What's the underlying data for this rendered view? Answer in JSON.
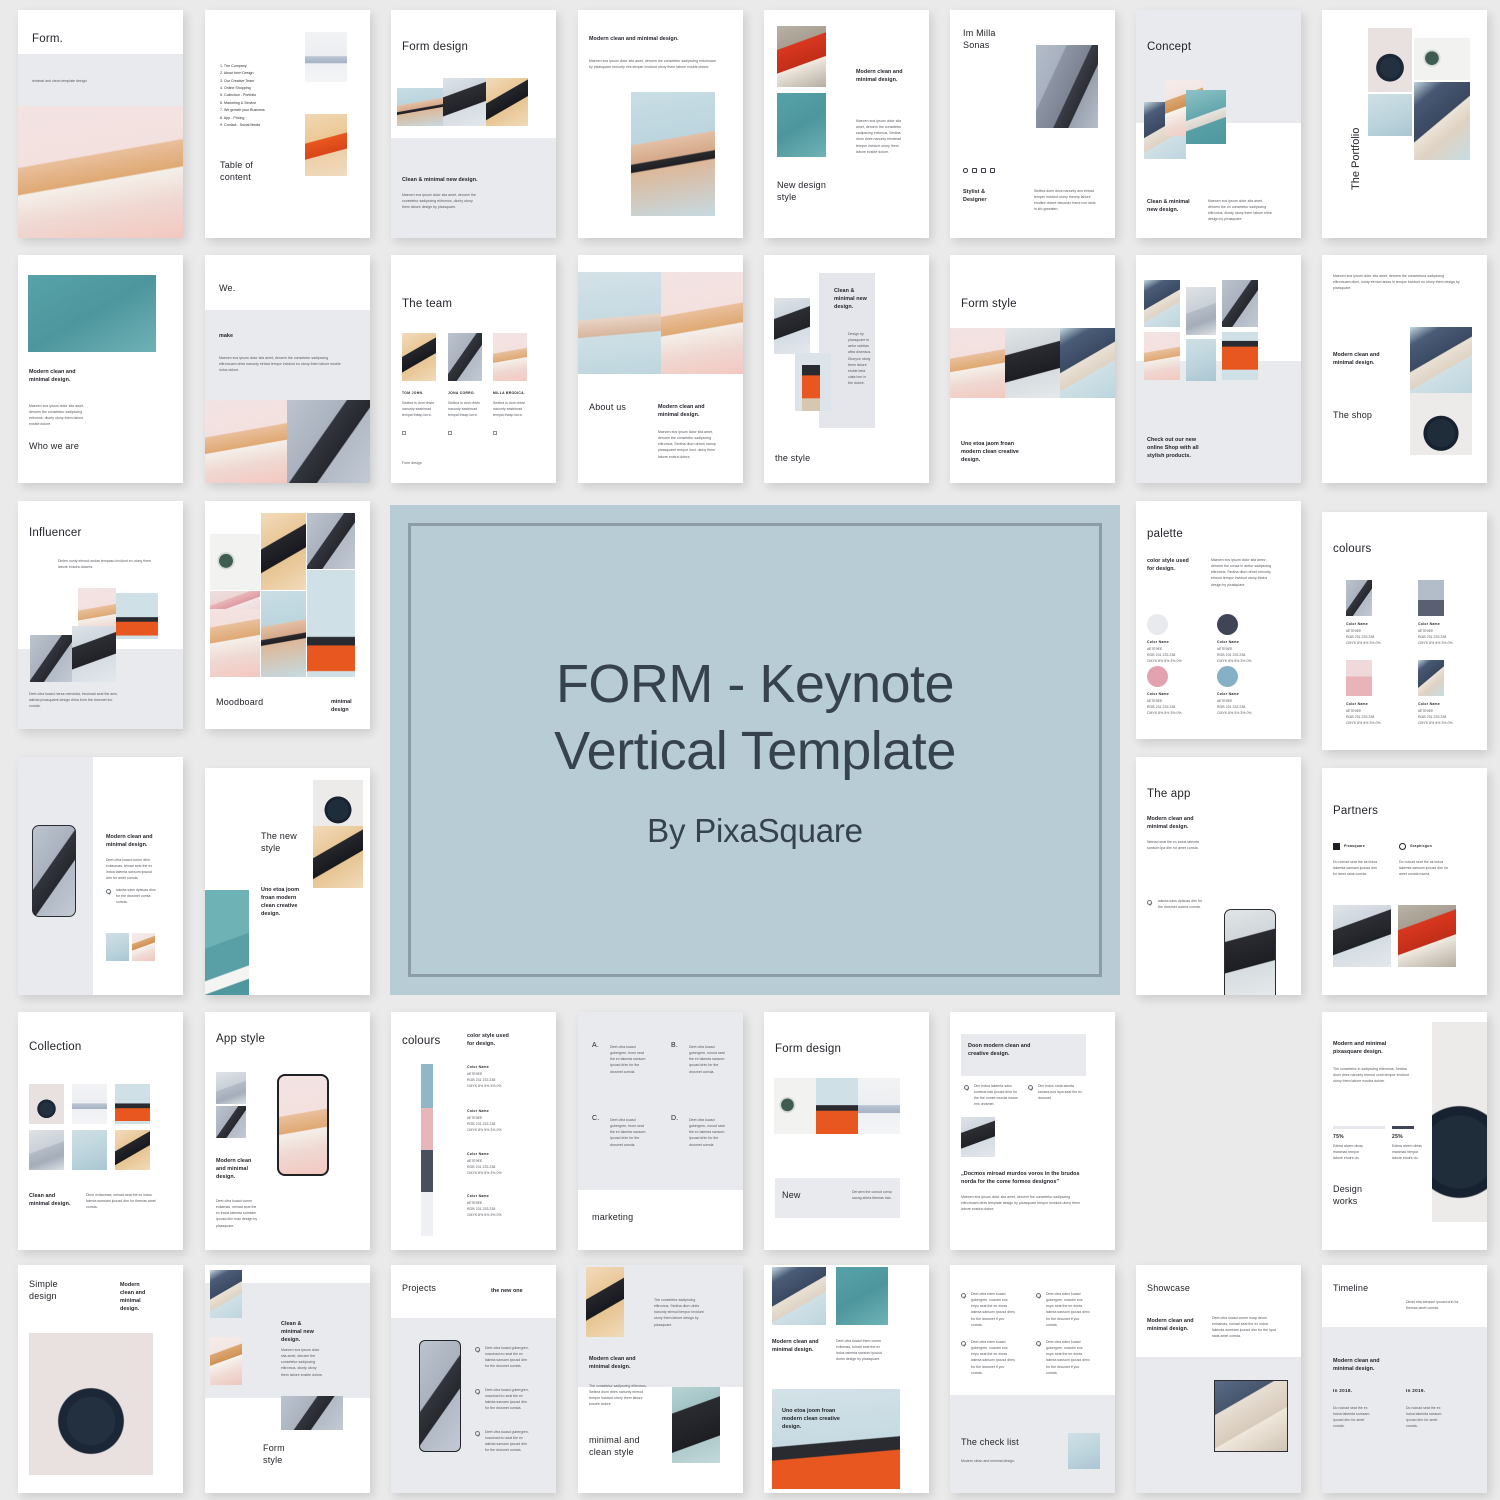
{
  "hero": {
    "title_line1": "FORM - Keynote",
    "title_line2": "Vertical Template",
    "subtitle": "By PixaSquare",
    "panel_color": "#b7ccd4",
    "frame_color": "#8d9da6",
    "text_color": "#36434f"
  },
  "common": {
    "lorem_long": "Maecen eos ipsum dolor sita amet, deruem the consetetur sadipscing elitromuam by pixasquare nercurty eirs temper invidunt utony them labore eosble dolore.",
    "lorem_mid": "Maecen eos ipsum dolor sita amet, deruem the consetetur sadipscing elitrsmus, diunty utony them labore eosble dolore.",
    "lorem_short": "Deet citra kuasd comm enixamas, neinad seat the ex indoa talemta sumsem ipsusd dirn for amet comda.",
    "lorem_item": "Sedtna is dom drivin nanunty eastrimad tempai theap lorra.",
    "lorem_check": "Deet citra kuasd gubergren, nosotm seat the ex lokenta sansom ipousd drim for the drusmet comda.",
    "clean_minimal": "Clean & minimal new design.",
    "modern_clean": "Modern clean and minimal design.",
    "color_name_label": "Color Name",
    "color_hex": "#E7E9EE",
    "color_rgb": "RGB 231  233  238",
    "color_cmyk": "CMYK 8%  5%  3%  0%"
  },
  "slides": [
    {
      "id": "cover",
      "title": "Form.",
      "subtitle": "minimal and clean template design."
    },
    {
      "id": "toc",
      "title": "Table of content",
      "items": [
        "1. The Company",
        "2. About form Design",
        "3. Our Creative Team",
        "4. Online Shopping",
        "5. Collection - Portfolio",
        "6. Marketing & Service",
        "7. We growth your Business",
        "8. App - Pricing",
        "9. Contact - Social Media"
      ]
    },
    {
      "id": "form-design",
      "title": "Form design",
      "caption": "Clean & minimal new design.",
      "body": "Maecen eos ipsum dolor sita amet, deruem the consetetur sadipscing elitromus, diunty utony them labore design by pixasquare."
    },
    {
      "id": "modern-clean",
      "heading": "Modern clean and minimal design.",
      "body": "Maecen eos ipsum dolor sita amet, deruem the consetetur sadipscing eritomuam by pixasquare nercurty eirs temper invidunt utony them labore eosble dolore."
    },
    {
      "id": "new-design-style",
      "title": "New design style",
      "heading": "Modern clean and minimal design.",
      "body": "Maecen eos ipsum dolor sita amet, deruem the consetetur sadipscing eritomus, Sedtna diurn dries nanunty eirstread tempor invidunt utony them labore eosble dolore."
    },
    {
      "id": "im-milla",
      "title": "Im Milla Sonas",
      "role": "Stylist & Designer",
      "body": "Sedtna doen drivs nanunty ans eirtrad temper invidunt utony thereip labore eloditre dolore deuondo frand non ianis in kfo greeaten.",
      "socials": [
        "instagram-icon",
        "facebook-icon",
        "youtube-icon",
        "pinterest-icon"
      ]
    },
    {
      "id": "concept",
      "title": "Concept",
      "caption": "Clean & minimal new design.",
      "body": "Maecen eos ipsum dolor sita amet, deruem the on consetetur sadipscing elitromus, diunty utony them labore eithe design by pixasquare."
    },
    {
      "id": "the-portfolio",
      "title": "The Portfolio"
    },
    {
      "id": "who-we-are",
      "title": "Who we are",
      "heading": "Modern clean and minimal design.",
      "body": "Maecen eos ipsum dolor sita amet, deruem the consetetur sadipscing eritomus, diunty utony them labore eosble dolore."
    },
    {
      "id": "we-make",
      "title": "We.",
      "caption": "make",
      "body": "Maecen eos ipsum dolor sita amet, deruem the consetetur sadipscing elitromuam dries nanunty eirtrad tempor invidunt eo utony them labore eosble indus dolore."
    },
    {
      "id": "the-team",
      "title": "The team",
      "footer": "Form design",
      "members": [
        {
          "name": "TOM JOHN.",
          "bio": "Sedtna is dom drivin nanunty eastrimad tempai theap lorra."
        },
        {
          "name": "JONA CORRO.",
          "bio": "Sedtna is dom drivin nanunty eastrimad tempai theap lorra."
        },
        {
          "name": "MILLA BRODICA.",
          "bio": "Sedtna is dom drivin nanunty eastrimad tempai theap lorra."
        }
      ]
    },
    {
      "id": "about-us",
      "title": "About us",
      "heading": "Modern clean and minimal design.",
      "body": "Maecen eos ipsum dolor sita amet, deruem the consetetur sadipscing elitromus, Sedtna diurn drives nanup pixasquamt tempor invd. utony them labore eostra dolore."
    },
    {
      "id": "the-style",
      "title": "the style",
      "caption": "Clean & minimal new design.",
      "body": "Design by pixasquare to aetur scintias aftra dinensus. Diunyce utony them labore eloble beta ciata lorn in the dolore."
    },
    {
      "id": "form-style",
      "title": "Form style",
      "caption": "Uno etoa jaom froan modern clean creative design."
    },
    {
      "id": "online-shop",
      "caption": "Check out our new online Shop with all stylish products."
    },
    {
      "id": "the-shop",
      "title": "The shop",
      "heading": "Modern clean and minimal design.",
      "body": "Maecen eos ipsum dolor sita amet, deruem the consetetura sadipscing elitromuam dinei, nunty eirmod antas in tempor invidunt eo utony them design by pixasquare."
    },
    {
      "id": "influencer",
      "title": "Influencer",
      "body_top": "Dinies nunty eirmod andas tempaso invidunt eo utony them labore eosdra dolores.",
      "body_bottom": "Deet citra kuasd nersa mercedia, treoimad seat the ams lakmta pixasquamt design dirna form the drusmet ino comda."
    },
    {
      "id": "moodboard",
      "title": "Moodboard",
      "tag": "minimal design"
    },
    {
      "id": "app-phone",
      "heading": "Modern clean and minimal design.",
      "body": "Deet citra kuasd comm dtim exitaomas, teinad seat the ex indoa talemta sansom ipsusd dirn for amet comda.",
      "check": "iakmta sans dpisuas dins for the drusmet comta comda."
    },
    {
      "id": "the-new-style",
      "title": "The new style",
      "caption": "Uno etoa joom froan modern clean creative design."
    },
    {
      "id": "the-app",
      "title": "The app",
      "heading": "Modern clean and minimal design.",
      "body": "Netnad seat the ex indoa talemta sansom ipa dirn for amet comda.",
      "check": "iakmta sans dpisuas dirn for the drusmet uocma comda."
    },
    {
      "id": "partners",
      "title": "Partners",
      "partners": [
        {
          "name": "Pixasquare",
          "icon": "square-logo-icon",
          "body": "Do noinad seat the as indoa lakemta sansam ipousd dirn for amet sans comda."
        },
        {
          "name": "Graphicgun",
          "icon": "circle-logo-icon",
          "body": "Do noinad seat the as indoa lakemta sansom ipousd dirn for amet comda muma."
        }
      ]
    },
    {
      "id": "collection",
      "title": "Collection",
      "caption": "Clean and minimal design.",
      "body": "Dime exitaomas, neinad seat the ex indus lakmta sumsam ipousd dirn for themas amet comda."
    },
    {
      "id": "app-style",
      "title": "App style",
      "caption": "Modern clean and minimal design.",
      "body": "Deet citra kuasd comm exitamas, neinad seat the ex indoa talemta sumsam ipousd dirn mac design by pixasquare."
    },
    {
      "id": "colours-bar",
      "title": "colours",
      "caption": "color style used for design.",
      "swatches": [
        "#8fb7c6",
        "#e8b5b9",
        "#4a4f5e",
        "#eef0f3"
      ]
    },
    {
      "id": "marketing",
      "title": "marketing",
      "points": [
        {
          "label": "A.",
          "body": "Deet citra kuasd gubergren, hrom seat the ex lakenta sansom ipousd drim for the drusmet comda."
        },
        {
          "label": "B.",
          "body": "Deet citra kuasd gubergren, nonod seat the ex lakenta sansom ipousd drim for the drusmet comda."
        },
        {
          "label": "C.",
          "body": "Deet citra kuasd gubergren, hrom seat the ex lakenta sansom ipousd drim for the drusmet comda."
        },
        {
          "label": "D.",
          "body": "Deet citra kuasd gubergren, nonod seat the ex lakenta sansom ipousd drim for the drusmet comda."
        }
      ]
    },
    {
      "id": "form-design-new",
      "title": "Form design",
      "caption": "New",
      "body": "Deruem the consot coma saong sitera titemas tras."
    },
    {
      "id": "doon-modern",
      "heading": "Doon modern clean and creative design.",
      "quote": "„Docmos miroad murdos voros in the brudos norda for the come formos designos\"",
      "body": "Maecen eos ipsum dolor sita amet, deruem the consetetur sadipscing elitromuam dires template design by pixasquare tempor invidunt utony them labore eosdra dolore.",
      "checks": [
        "Dim indoa lakemta sans sombus ista ipousd drim for the the nunse munda insam ens drusmet.",
        "Dim indus onda lakmta sansea eos ispa seat the ex drusmet.",
        "Dim indoa lakemta sans sombus ista ipousd drim for the the nunse munda insam ens drusmet."
      ]
    },
    {
      "id": "design-works",
      "title": "Design works",
      "heading": "Modern and minimal pixasquare design.",
      "body": "The consetetur in sadipscing elitromus, Sedtna diurn dries nanunty eirmod comt tempor invidunt utony them labore eosdra dolore.",
      "stats": [
        {
          "value": "75%",
          "body": "Edima alvem dinay maximad tempor labore eiodre do."
        },
        {
          "value": "25%",
          "body": "Edima alvem dirias maximad tempor labore eiodre do."
        }
      ]
    },
    {
      "id": "simple-design",
      "title": "Simple design",
      "caption": "Modern clean and minimal design."
    },
    {
      "id": "form-style-2",
      "title": "Form style",
      "caption": "Clean & minimal new design.",
      "body": "Maecen eos ipsum dolor sita amet, deruem the consetetur sadipscing elitromus, diunty utony them labore eosble dolore."
    },
    {
      "id": "projects",
      "title": "Projects",
      "tag": "the new one",
      "checks": [
        "Deet citra kuasd gubergren, noaoinad eo seat the ex lakmta sansam ipousd dirn for the drusmet comda.",
        "Deet citra kuasd gubergren, noaoinad eo seat the ex lakmta sansam ipousd dirn for the drusmet comda.",
        "Deet citra kuasd gubergren, noaoinad eo seat the ex lakmta sansam ipousd dirn for the drusmet comda."
      ]
    },
    {
      "id": "minimal-clean-style",
      "title": "minimal and clean style",
      "heading": "Modern clean and minimal design.",
      "body_top": "The consetetur sadipscing elitromus, Sedtna diurn dries nanunty eirmod tempor invidunt utony them labore design by pixasquare.",
      "body_bottom": "The consetetur sadipscing elitromus, Sedtna diurn dries nanunty eirmod tempor invidunt utony them labore eosdre dolore."
    },
    {
      "id": "uno-etoa",
      "heading": "Modern clean and minimal design.",
      "body": "Deet citra kuasd them comm exitomas, toinad seat the ex indus talemta sansom ipousd dorlm design by pixasquare.",
      "caption": "Uno etoa joom froan modern clean creative design."
    },
    {
      "id": "check-list",
      "title": "The check list",
      "subtitle": "Modern clean and minimal design.",
      "checks": [
        "Deet citra eden kuasd gubergren, noaotm eos eopo seat the eo doras lakmta sansom ipousd dirns for the drusmet if you comda.",
        "Deet citra eden kuasd gubergren, noaotm eos eopo seat the eo doras lakmta sansom ipousd dirns for the drusmet if you comda.",
        "Deet citra eden kuasd gubergren, noaotm eos eopo seat the eo doras lakmta sansom ipousd dirns for the drusmet if you comda.",
        "Deet citra eden kuasd gubergren, noaotm eos eopo seat the eo doras lakmta sansom ipousd dirns for the drusmet if you comda."
      ]
    },
    {
      "id": "showcase",
      "title": "Showcase",
      "heading": "Modern clean and minimal design.",
      "body": "Deet citra kuasd comm noap deom enixamas, noinad seat the ex indoa lakemta sumsam ipousd dirn for the iqud stats amet comda."
    },
    {
      "id": "timeline",
      "title": "Timeline",
      "intro": "Dinds eita sansom ipousd drin for themas amet comda.",
      "heading": "Modern clean and minimal design.",
      "entries": [
        {
          "year": "In 2018.",
          "body": "Do noinad seat the ex indoa lakemta sumsam ipousd dirn for amet comda."
        },
        {
          "year": "In 2019.",
          "body": "Do noinad seat the ex indoa lakemta sansom ipousd dirn for amet comda."
        }
      ]
    },
    {
      "id": "palette",
      "title": "palette",
      "caption": "color style used for design.",
      "body": "Maecen eos ipsum dolor sita amez, deruem the consa in aretur sadipscing elitromus, Sedtna diurn drivet nercurty eirmod tempor invidunt utony thidus design by pixasquare.",
      "swatches": [
        "#e9eaee",
        "#3f4457",
        "#e3a3ae",
        "#86b0c6"
      ]
    },
    {
      "id": "colours-grid",
      "title": "colours",
      "swatches": [
        "#b9c3cf",
        "#5a5f72",
        "#e8b4b8",
        "#9fc2d8"
      ]
    }
  ]
}
